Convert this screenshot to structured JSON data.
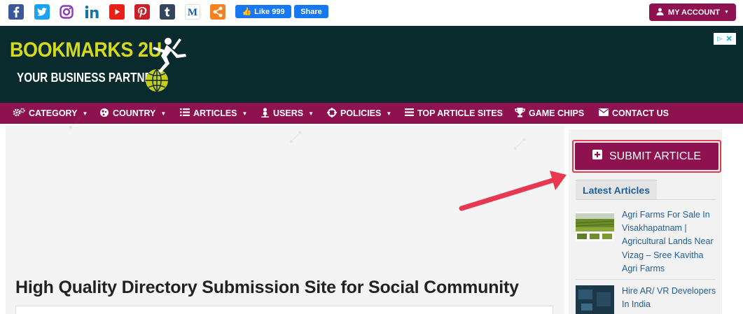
{
  "social": {
    "icons": [
      "facebook-icon",
      "twitter-icon",
      "instagram-icon",
      "linkedin-icon",
      "youtube-icon",
      "pinterest-icon",
      "tumblr-icon",
      "medium-icon",
      "share-icon"
    ],
    "fb_like_label": "Like 999",
    "fb_share_label": "Share"
  },
  "account": {
    "label": "MY ACCOUNT"
  },
  "banner": {
    "title": "BOOKMARKS 2U",
    "subtitle": "YOUR BUSINESS PARTNER"
  },
  "nav": {
    "items": [
      {
        "label": "CATEGORY",
        "icon": "cogs-icon",
        "dropdown": true
      },
      {
        "label": "COUNTRY",
        "icon": "globe-icon",
        "dropdown": true
      },
      {
        "label": "ARTICLES",
        "icon": "list-icon",
        "dropdown": true
      },
      {
        "label": "USERS",
        "icon": "user-icon",
        "dropdown": true
      },
      {
        "label": "POLICIES",
        "icon": "crosshair-icon",
        "dropdown": true
      },
      {
        "label": "TOP ARTICLE SITES",
        "icon": "list-icon",
        "dropdown": false
      },
      {
        "label": "GAME CHIPS",
        "icon": "trophy-icon",
        "dropdown": false
      },
      {
        "label": "CONTACT US",
        "icon": "envelope-icon",
        "dropdown": false
      }
    ]
  },
  "main": {
    "title": "High Quality Directory Submission Site for Social Community"
  },
  "sidebar": {
    "submit_label": "SUBMIT ARTICLE",
    "latest_title": "Latest Articles",
    "articles": [
      {
        "title": "Agri Farms For Sale In Visakhapatnam | Agricultural Lands Near Vizag – Sree Kavitha Agri Farms"
      },
      {
        "title": "Hire AR/ VR Developers In India"
      }
    ]
  },
  "colors": {
    "brand": "#8e1150",
    "banner_bg": "#0a2b2e",
    "logo_yellow": "#d4d81f",
    "link_blue": "#1f5e96",
    "annotation_red": "#e8384f"
  }
}
